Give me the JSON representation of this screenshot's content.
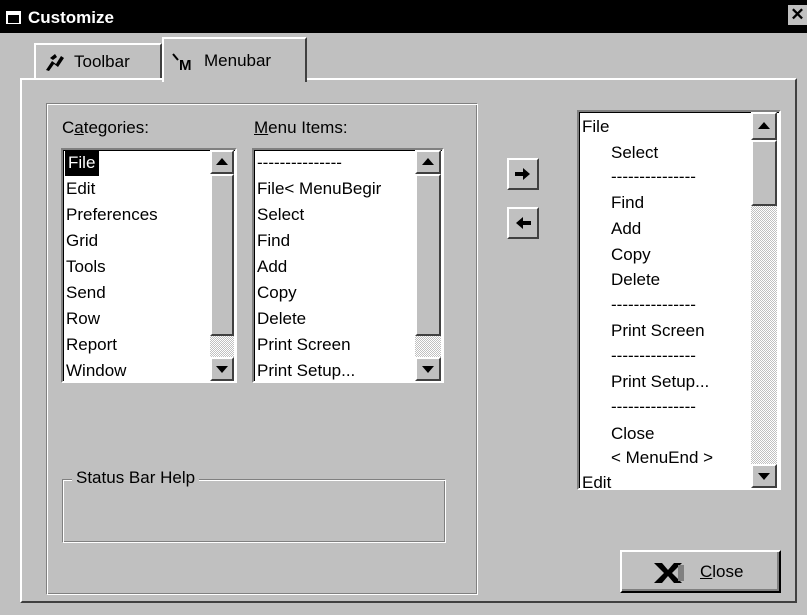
{
  "window": {
    "title": "Customize",
    "close_glyph": "✕"
  },
  "tabs": [
    {
      "label": "Toolbar",
      "icon": "toolbar-icon",
      "active": false
    },
    {
      "label": "Menubar",
      "icon": "menubar-icon",
      "active": true
    }
  ],
  "categories": {
    "label_pre": "C",
    "label_accel": "a",
    "label_post": "tegories:",
    "items": [
      "File",
      "Edit",
      "Preferences",
      "Grid",
      "Tools",
      "Send",
      "Row",
      "Report",
      "Window"
    ],
    "selected": "File"
  },
  "menu_items": {
    "label_accel": "M",
    "label_post": "enu Items:",
    "items": [
      "---------------",
      "File< MenuBegir",
      "Select",
      "Find",
      "Add",
      "Copy",
      "Delete",
      "Print Screen",
      "Print Setup..."
    ]
  },
  "menubar_list": {
    "items": [
      "File",
      "Select",
      "---------------",
      "Find",
      "Add",
      "Copy",
      "Delete",
      "---------------",
      "Print Screen",
      "---------------",
      "Print Setup...",
      "---------------",
      "Close",
      "< MenuEnd >",
      "Edit"
    ]
  },
  "buttons": {
    "add_icon": "right-arrow-icon",
    "remove_icon": "left-arrow-icon",
    "close_accel": "C",
    "close_post": "lose",
    "close_icon": "close-x-icon"
  },
  "status_bar_help": {
    "label": "Status Bar Help",
    "value": ""
  }
}
